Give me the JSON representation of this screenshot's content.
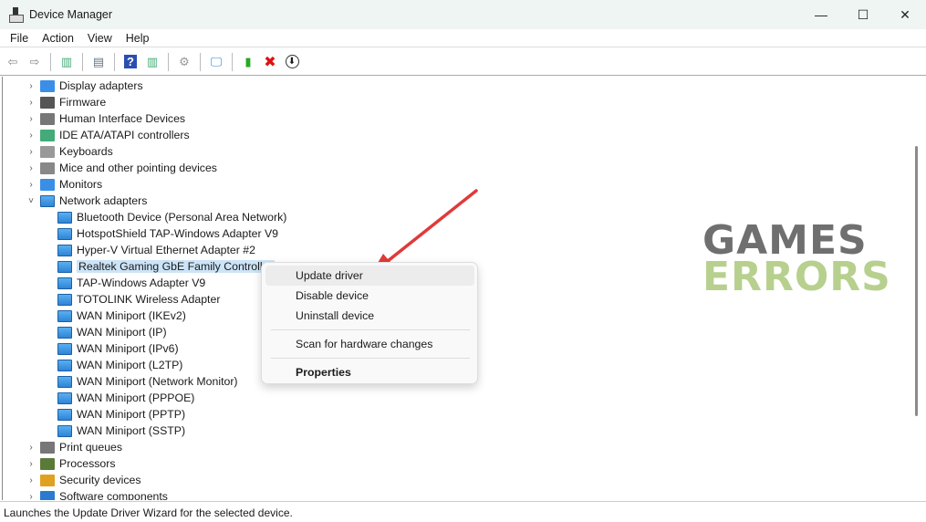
{
  "window": {
    "title": "Device Manager",
    "minimize": "—",
    "maximize": "☐",
    "close": "✕"
  },
  "menu": [
    "File",
    "Action",
    "View",
    "Help"
  ],
  "toolbar": [
    "back-icon",
    "forward-icon",
    "show-hide-console-tree-icon",
    "properties-icon",
    "help-icon",
    "action-pane-icon",
    "update-driver-icon",
    "scan-hardware-icon",
    "enable-device-icon",
    "uninstall-device-icon",
    "disable-device-icon"
  ],
  "tree": {
    "categories_top": [
      {
        "label": "Display adapters",
        "icon": "#3a8ee6"
      },
      {
        "label": "Firmware",
        "icon": "#555"
      },
      {
        "label": "Human Interface Devices",
        "icon": "#777"
      },
      {
        "label": "IDE ATA/ATAPI controllers",
        "icon": "#4a7"
      },
      {
        "label": "Keyboards",
        "icon": "#999"
      },
      {
        "label": "Mice and other pointing devices",
        "icon": "#888"
      },
      {
        "label": "Monitors",
        "icon": "#3a8ee6"
      }
    ],
    "network": {
      "label": "Network adapters",
      "children": [
        "Bluetooth Device (Personal Area Network)",
        "HotspotShield TAP-Windows Adapter V9",
        "Hyper-V Virtual Ethernet Adapter #2",
        "Realtek Gaming GbE Family Controller",
        "TAP-Windows Adapter V9",
        "TOTOLINK Wireless Adapter",
        "WAN Miniport (IKEv2)",
        "WAN Miniport (IP)",
        "WAN Miniport (IPv6)",
        "WAN Miniport (L2TP)",
        "WAN Miniport (Network Monitor)",
        "WAN Miniport (PPPOE)",
        "WAN Miniport (PPTP)",
        "WAN Miniport (SSTP)"
      ]
    },
    "categories_bottom": [
      {
        "label": "Print queues",
        "icon": "#777"
      },
      {
        "label": "Processors",
        "icon": "#5a7a3a"
      },
      {
        "label": "Security devices",
        "icon": "#e0a020"
      },
      {
        "label": "Software components",
        "icon": "#2a7ad0"
      }
    ]
  },
  "context_menu": {
    "update": "Update driver",
    "disable": "Disable device",
    "uninstall": "Uninstall device",
    "scan": "Scan for hardware changes",
    "properties": "Properties"
  },
  "watermark": {
    "line1": "GAMES",
    "line2": "ERRORS"
  },
  "status": "Launches the Update Driver Wizard for the selected device."
}
